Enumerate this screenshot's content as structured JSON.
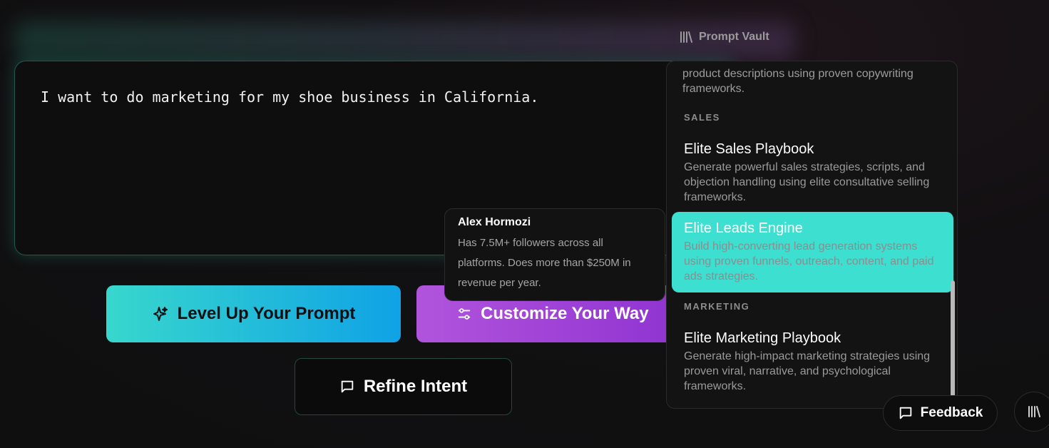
{
  "vault": {
    "label": "Prompt Vault",
    "icon": "library-icon"
  },
  "prompt": {
    "text": "I want to do marketing for my shoe business in California."
  },
  "buttons": {
    "level_up": "Level Up Your Prompt",
    "customize": "Customize Your Way",
    "refine": "Refine Intent"
  },
  "tooltip": {
    "name": "Alex Hormozi",
    "description": "Has 7.5M+ followers across all platforms. Does more than $250M in revenue per year."
  },
  "dropdown": {
    "partial_text": "product descriptions using proven copywriting frameworks.",
    "categories": [
      {
        "label": "SALES",
        "items": [
          {
            "title": "Elite Sales Playbook",
            "description": "Generate powerful sales strategies, scripts, and objection handling using elite consultative selling frameworks."
          },
          {
            "title": "Elite Leads Engine",
            "description": "Build high-converting lead generation systems using proven funnels, outreach, content, and paid ads strategies."
          }
        ]
      },
      {
        "label": "MARKETING",
        "items": [
          {
            "title": "Elite Marketing Playbook",
            "description": "Generate high-impact marketing strategies using proven viral, narrative, and psychological frameworks."
          }
        ]
      }
    ]
  },
  "feedback": {
    "label": "Feedback"
  },
  "colors": {
    "accent_teal": "#3ddfd0",
    "accent_purple": "#9b3fd6",
    "accent_blue": "#10a2e6"
  }
}
